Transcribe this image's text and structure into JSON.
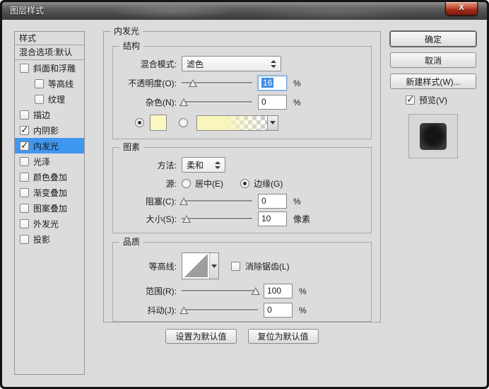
{
  "window": {
    "title": "图层样式"
  },
  "icons": {
    "close": "X",
    "check": "✓"
  },
  "sidebar": {
    "header": "样式",
    "blending_item": "混合选项:默认",
    "items": [
      {
        "label": "斜面和浮雕",
        "checked": false,
        "indent": false,
        "selected": false
      },
      {
        "label": "等高线",
        "checked": false,
        "indent": true,
        "selected": false
      },
      {
        "label": "纹理",
        "checked": false,
        "indent": true,
        "selected": false
      },
      {
        "label": "描边",
        "checked": false,
        "indent": false,
        "selected": false
      },
      {
        "label": "内阴影",
        "checked": true,
        "indent": false,
        "selected": false
      },
      {
        "label": "内发光",
        "checked": true,
        "indent": false,
        "selected": true
      },
      {
        "label": "光泽",
        "checked": false,
        "indent": false,
        "selected": false
      },
      {
        "label": "颜色叠加",
        "checked": false,
        "indent": false,
        "selected": false
      },
      {
        "label": "渐变叠加",
        "checked": false,
        "indent": false,
        "selected": false
      },
      {
        "label": "图案叠加",
        "checked": false,
        "indent": false,
        "selected": false
      },
      {
        "label": "外发光",
        "checked": false,
        "indent": false,
        "selected": false
      },
      {
        "label": "投影",
        "checked": false,
        "indent": false,
        "selected": false
      }
    ]
  },
  "panel": {
    "title": "内发光",
    "structure": {
      "legend": "结构",
      "blend_mode_label": "混合模式:",
      "blend_mode_value": "滤色",
      "opacity_label": "不透明度(O):",
      "opacity_value": "16",
      "opacity_unit": "%",
      "noise_label": "杂色(N):",
      "noise_value": "0",
      "noise_unit": "%"
    },
    "elements": {
      "legend": "图素",
      "technique_label": "方法:",
      "technique_value": "柔和",
      "source_label": "源:",
      "source_center_label": "居中(E)",
      "source_edge_label": "边缘(G)",
      "choke_label": "阻塞(C):",
      "choke_value": "0",
      "choke_unit": "%",
      "size_label": "大小(S):",
      "size_value": "10",
      "size_unit": "像素"
    },
    "quality": {
      "legend": "品质",
      "contour_label": "等高线:",
      "antialias_label": "消除锯齿(L)",
      "range_label": "范围(R):",
      "range_value": "100",
      "range_unit": "%",
      "jitter_label": "抖动(J):",
      "jitter_value": "0",
      "jitter_unit": "%"
    },
    "set_default_label": "设置为默认值",
    "reset_default_label": "复位为默认值"
  },
  "actions": {
    "ok": "确定",
    "cancel": "取消",
    "new_style": "新建样式(W)...",
    "preview": "预览(V)"
  },
  "states": {
    "checkboxes": {
      "preview": true,
      "antialias": false
    },
    "radios": {
      "color_solid": true,
      "color_gradient": false,
      "source_center": false,
      "source_edge": true
    }
  },
  "sliders": {
    "opacity_pct": 16,
    "noise_pct": 3,
    "choke_pct": 3,
    "size_pct": 7,
    "range_pct": 97,
    "jitter_pct": 3
  },
  "colors": {
    "selection_blue": "#3f97f0",
    "glow_yellow": "#fbf8c3",
    "focus_blue": "#3f8ce0",
    "close_red": "#b03320",
    "dialog_bg": "#dcdcdc"
  }
}
